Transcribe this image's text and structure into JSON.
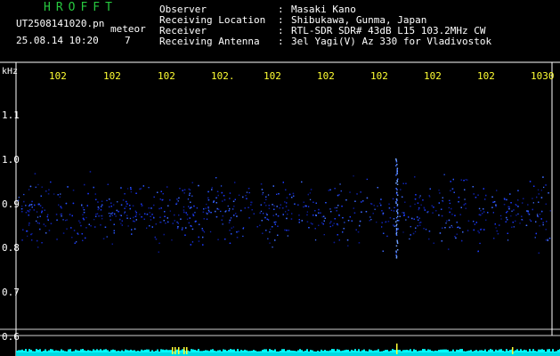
{
  "app_title": "HROFFT",
  "file_name": "UT2508141020.pn",
  "file_suffix": "meteor",
  "datetime": "25.08.14 10:20",
  "counter": "7",
  "info": [
    {
      "key": "Observer",
      "value": "Masaki Kano"
    },
    {
      "key": "Receiving Location",
      "value": "Shibukawa, Gunma, Japan"
    },
    {
      "key": "Receiver",
      "value": "RTL-SDR SDR# 43dB L15 103.2MHz CW"
    },
    {
      "key": "Receiving Antenna",
      "value": "3el Yagi(V) Az 330 for Vladivostok"
    }
  ],
  "info_separator": ":",
  "axis_unit": "kHz",
  "top_ticks": [
    "102",
    "102",
    "102",
    "102.",
    "102",
    "102",
    "102",
    "102",
    "102",
    "1030"
  ],
  "left_ticks": [
    "1.1",
    "1.0",
    "0.9",
    "0.8",
    "0.7",
    "0.6"
  ],
  "colors": {
    "background": "#000000",
    "title": "#27c93f",
    "text": "#ffffff",
    "tick": "#ffff33",
    "signal": "#1d3bff",
    "cursor": "#00ffff"
  }
}
